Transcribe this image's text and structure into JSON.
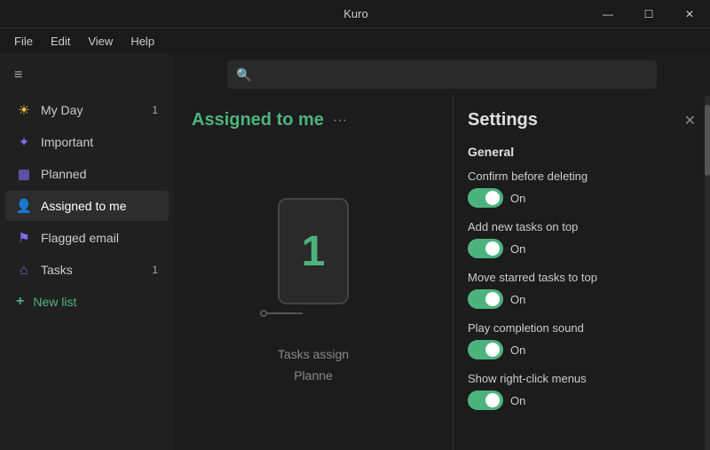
{
  "titleBar": {
    "title": "Kuro",
    "minimizeLabel": "—",
    "maximizeLabel": "☐",
    "closeLabel": "✕"
  },
  "menuBar": {
    "items": [
      "File",
      "Edit",
      "View",
      "Help"
    ]
  },
  "search": {
    "placeholder": "🔍"
  },
  "sidebar": {
    "hamburgerIcon": "≡",
    "items": [
      {
        "label": "My Day",
        "icon": "☀",
        "iconClass": "icon-sun",
        "badge": "1",
        "active": false
      },
      {
        "label": "Important",
        "icon": "✦",
        "iconClass": "icon-star",
        "badge": "",
        "active": false
      },
      {
        "label": "Planned",
        "icon": "▦",
        "iconClass": "icon-grid",
        "badge": "",
        "active": false
      },
      {
        "label": "Assigned to me",
        "icon": "👤",
        "iconClass": "icon-person",
        "badge": "",
        "active": true
      },
      {
        "label": "Flagged email",
        "icon": "⚑",
        "iconClass": "icon-flag",
        "badge": "",
        "active": false
      },
      {
        "label": "Tasks",
        "icon": "⌂",
        "iconClass": "icon-house",
        "badge": "1",
        "active": false
      }
    ],
    "newList": {
      "icon": "+",
      "label": "New list"
    }
  },
  "taskView": {
    "title": "Assigned to me",
    "moreIcon": "···",
    "phoneNumber": "1",
    "tasksAssignedText": "Tasks assign",
    "plannedText": "Planne"
  },
  "settings": {
    "title": "Settings",
    "closeIcon": "✕",
    "sectionTitle": "General",
    "options": [
      {
        "label": "Confirm before deleting",
        "toggleState": "On"
      },
      {
        "label": "Add new tasks on top",
        "toggleState": "On"
      },
      {
        "label": "Move starred tasks to top",
        "toggleState": "On"
      },
      {
        "label": "Play completion sound",
        "toggleState": "On"
      },
      {
        "label": "Show right-click menus",
        "toggleState": "On"
      }
    ]
  }
}
